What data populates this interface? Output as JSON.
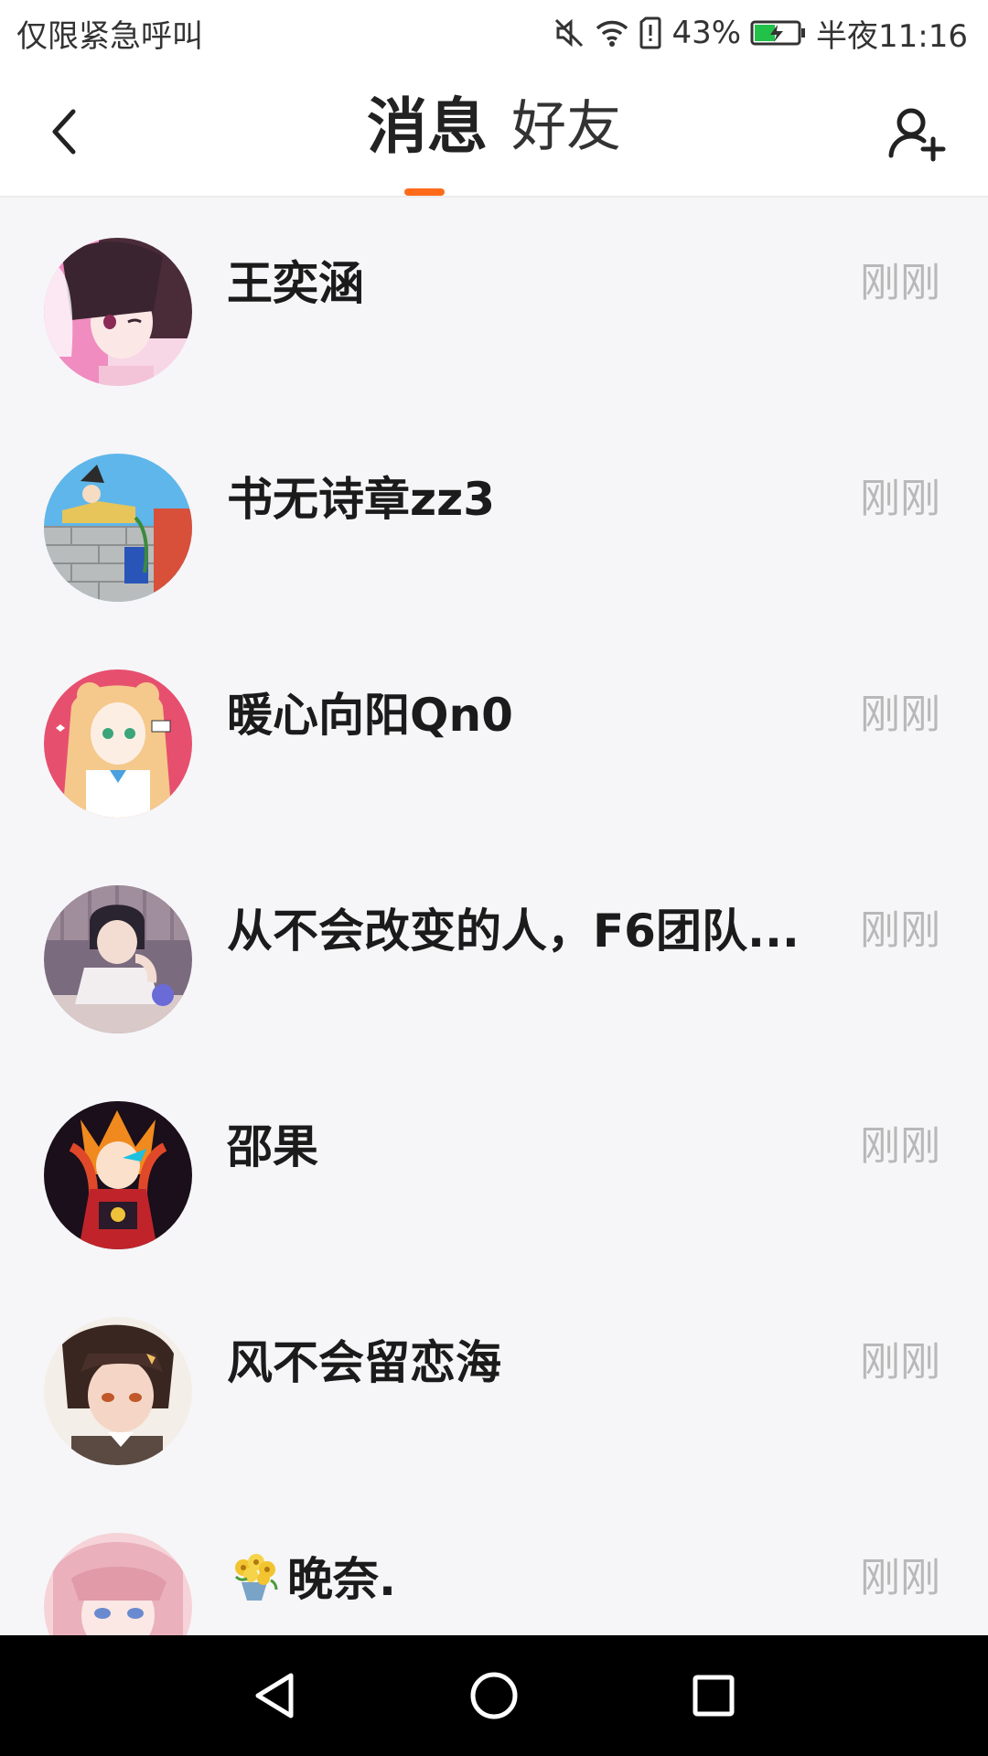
{
  "status_bar": {
    "carrier": "仅限紧急呼叫",
    "battery_percent": "43%",
    "time": "半夜11:16",
    "icons": [
      "mute-icon",
      "wifi-icon",
      "sim-alert-icon",
      "battery-charging-icon"
    ]
  },
  "header": {
    "back_icon": "chevron-left-icon",
    "tabs": [
      {
        "label": "消息",
        "active": true
      },
      {
        "label": "好友",
        "active": false
      }
    ],
    "add_friend_icon": "add-person-icon",
    "accent_color": "#ff6b1a"
  },
  "messages": [
    {
      "name": "王奕涵",
      "time": "刚刚",
      "avatar": "anime-girl-pink-avatar"
    },
    {
      "name": "书无诗章zz3",
      "time": "刚刚",
      "avatar": "rooftop-scene-avatar"
    },
    {
      "name": "暖心向阳Qn0",
      "time": "刚刚",
      "avatar": "blonde-girl-pink-bg-avatar"
    },
    {
      "name": "从不会改变的人，F6团队...",
      "time": "刚刚",
      "avatar": "boy-at-desk-avatar"
    },
    {
      "name": "邵果",
      "time": "刚刚",
      "avatar": "fiery-warrior-avatar"
    },
    {
      "name": "风不会留恋海",
      "time": "刚刚",
      "avatar": "brown-hair-boy-avatar"
    },
    {
      "name": "晚奈.",
      "time": "刚刚",
      "avatar": "pink-hair-girl-avatar",
      "prefix_icon": "flower-bouquet-icon"
    }
  ],
  "nav_bar": {
    "icons": [
      "back-triangle-icon",
      "home-circle-icon",
      "recents-square-icon"
    ]
  }
}
